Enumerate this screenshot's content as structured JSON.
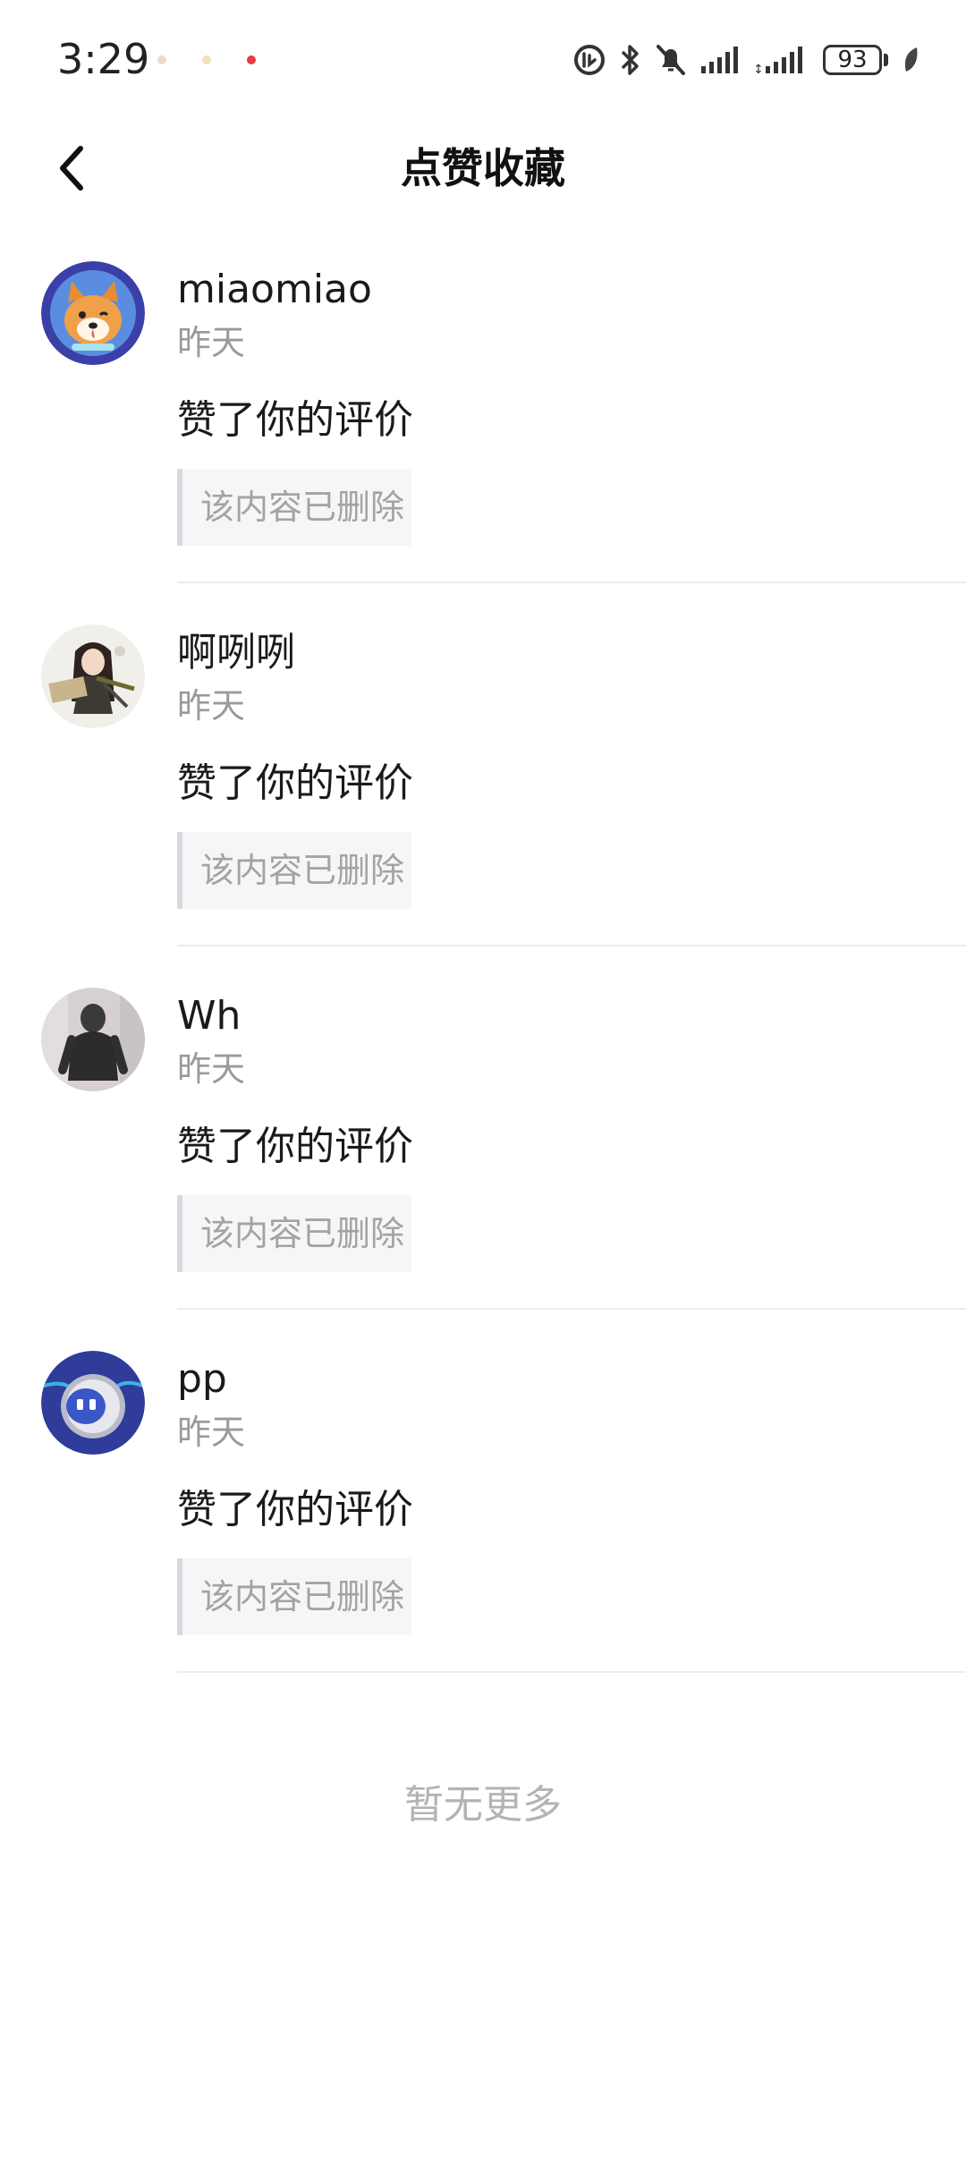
{
  "status_bar": {
    "time": "3:29",
    "battery": "93",
    "dot_colors": [
      "#f3d9c4",
      "#f0e2b8",
      "#e53b43"
    ]
  },
  "header": {
    "title": "点赞收藏",
    "back_icon": "chevron-left-icon"
  },
  "items": [
    {
      "name": "miaomiao",
      "time": "昨天",
      "action": "赞了你的评价",
      "quote": "该内容已删除",
      "avatar": "shiba-dog-avatar"
    },
    {
      "name": "啊咧咧",
      "time": "昨天",
      "action": "赞了你的评价",
      "quote": "该内容已删除",
      "avatar": "anime-girl-avatar"
    },
    {
      "name": "Wh",
      "time": "昨天",
      "action": "赞了你的评价",
      "quote": "该内容已删除",
      "avatar": "gorilla-avatar"
    },
    {
      "name": "pp",
      "time": "昨天",
      "action": "赞了你的评价",
      "quote": "该内容已删除",
      "avatar": "robot-avatar"
    }
  ],
  "footer": {
    "text": "暂无更多"
  }
}
